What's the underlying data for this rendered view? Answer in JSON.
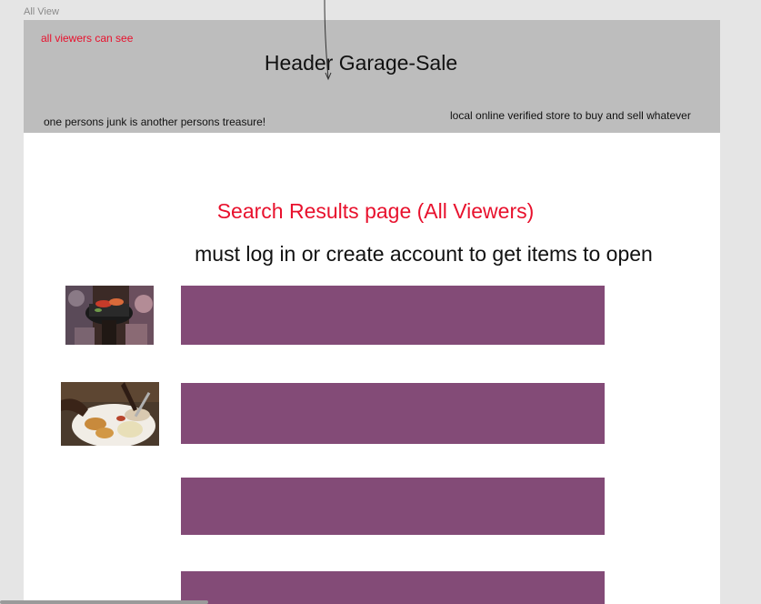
{
  "frame": {
    "label": "All View"
  },
  "header": {
    "note": "all viewers can see",
    "title": "Header Garage-Sale",
    "tagline_left": "one persons junk is another persons treasure!",
    "tagline_right": "local online verified store to buy and sell whatever"
  },
  "main": {
    "heading": "Search Results page (All Viewers)",
    "subheading": "must log in or create account to get items to open"
  },
  "results": {
    "count_visible": 4,
    "bar_color": "#834b77",
    "thumbnails": [
      "grill-photo",
      "food-plate-photo"
    ]
  },
  "colors": {
    "accent_red": "#e8112d",
    "header_bg": "#bdbdbd",
    "canvas_bg": "#e5e5e5",
    "result_bar": "#834b77"
  }
}
